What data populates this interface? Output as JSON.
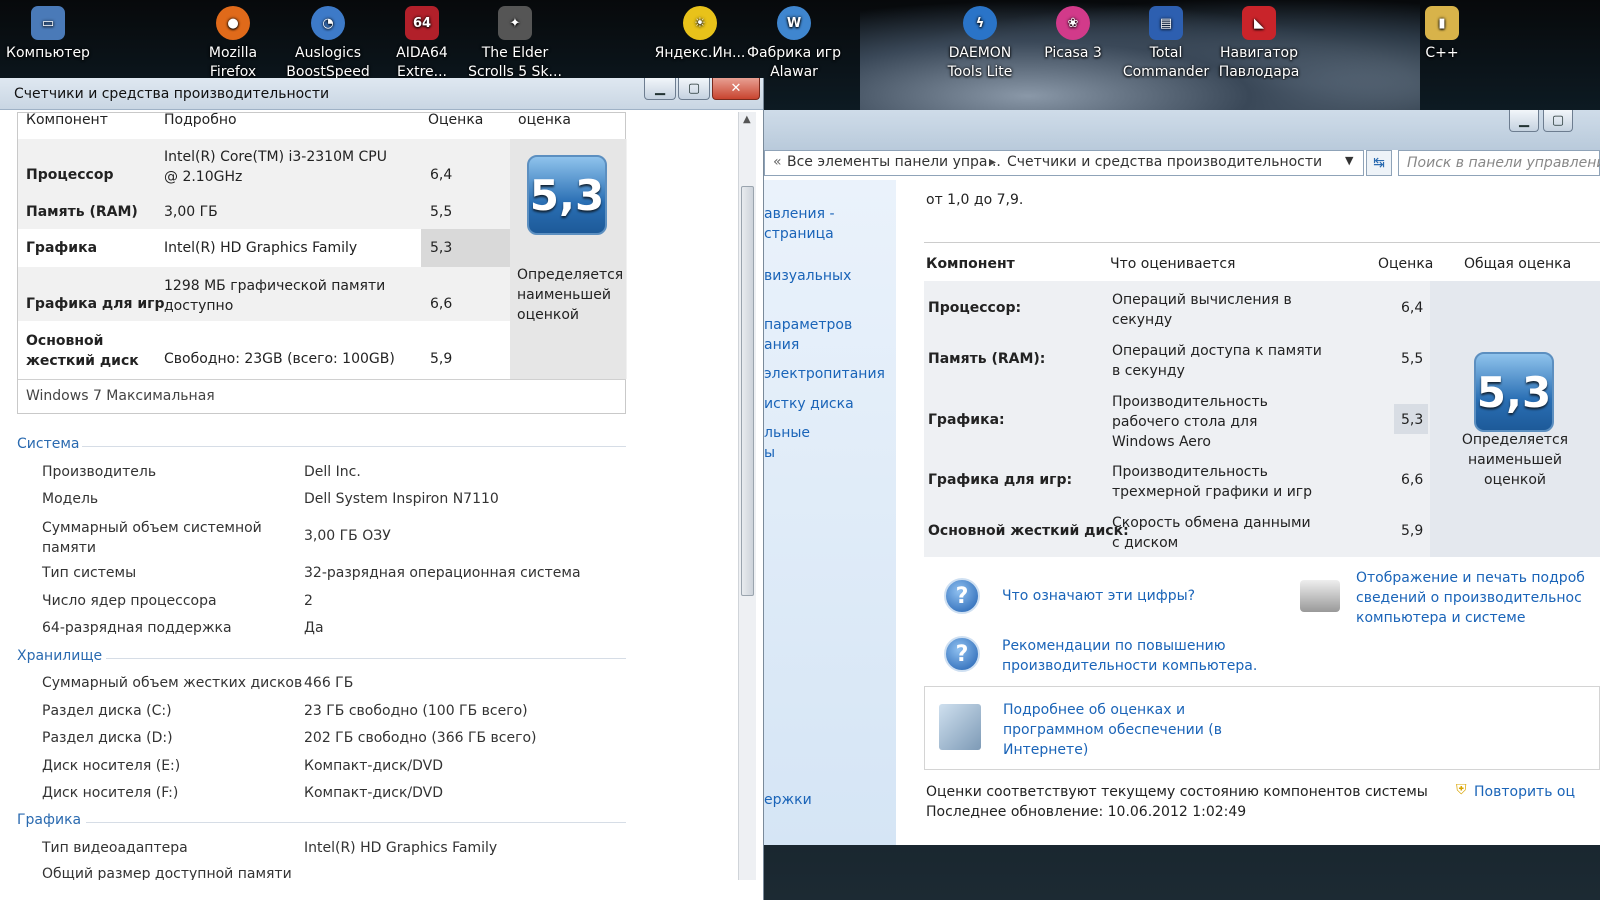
{
  "desktop": {
    "icons": [
      {
        "label": "Компьютер",
        "color": "#4a7ab8"
      },
      {
        "label": "Mozilla Firefox",
        "color": "#e06a1a"
      },
      {
        "label": "Auslogics BoostSpeed",
        "color": "#3d7ac8"
      },
      {
        "label": "AIDA64 Extre...",
        "color": "#b2202a"
      },
      {
        "label": "The Elder Scrolls 5 Sk...",
        "color": "#555555"
      },
      {
        "label": "Яндекс.Ин...",
        "color": "#e8c21a"
      },
      {
        "label": "Фабрика игр Alawar",
        "color": "#3f86cf"
      },
      {
        "label": "DAEMON Tools Lite",
        "color": "#2a74c8"
      },
      {
        "label": "Picasa 3",
        "color": "#d23a8a"
      },
      {
        "label": "Total Commander",
        "color": "#2d5fb0"
      },
      {
        "label": "Навигатор Павлодара",
        "color": "#c9242a"
      },
      {
        "label": "C++",
        "color": "#d8b34a"
      }
    ]
  },
  "left_window": {
    "title": "Счетчики и средства производительности",
    "buttons": {
      "minimize": "▁",
      "maximize": "▢",
      "close": "✕"
    },
    "score_table": {
      "headers": {
        "component": "Компонент",
        "details": "Подробно",
        "score": "Оценка",
        "overall": "оценка"
      },
      "rows": [
        {
          "component": "Процессор",
          "details": "Intel(R) Core(TM) i3-2310M CPU @ 2.10GHz",
          "score": "6,4"
        },
        {
          "component": "Память (RAM)",
          "details": "3,00 ГБ",
          "score": "5,5"
        },
        {
          "component": "Графика",
          "details": "Intel(R) HD Graphics Family",
          "score": "5,3"
        },
        {
          "component": "Графика для игр",
          "details": "1298 МБ графической памяти доступно",
          "score": "6,6"
        },
        {
          "component": "Основной жесткий диск",
          "details": "Свободно: 23GB (всего: 100GB)",
          "score": "5,9"
        }
      ],
      "base_score": "5,3",
      "base_note": "Определяется наименьшей оценкой",
      "os": "Windows 7 Максимальная"
    },
    "system": {
      "heading": "Система",
      "items": [
        {
          "key": "Производитель",
          "value": "Dell Inc."
        },
        {
          "key": "Модель",
          "value": "Dell System Inspiron N7110"
        },
        {
          "key": "Суммарный объем системной памяти",
          "value": "3,00 ГБ ОЗУ"
        },
        {
          "key": "Тип системы",
          "value": "32-разрядная операционная система"
        },
        {
          "key": "Число ядер процессора",
          "value": "2"
        },
        {
          "key": "64-разрядная поддержка",
          "value": "Да"
        }
      ]
    },
    "storage": {
      "heading": "Хранилище",
      "items": [
        {
          "key": "Суммарный объем жестких дисков",
          "value": "466 ГБ"
        },
        {
          "key": "Раздел диска (C:)",
          "value": "23 ГБ свободно (100 ГБ всего)"
        },
        {
          "key": "Раздел диска (D:)",
          "value": "202 ГБ свободно (366 ГБ всего)"
        },
        {
          "key": "Диск носителя (E:)",
          "value": "Компакт-диск/DVD"
        },
        {
          "key": "Диск носителя (F:)",
          "value": "Компакт-диск/DVD"
        }
      ]
    },
    "graphics": {
      "heading": "Графика",
      "items": [
        {
          "key": "Тип видеоадаптера",
          "value": "Intel(R) HD Graphics Family"
        },
        {
          "key": "Общий размер доступной памяти",
          "value": ""
        }
      ]
    }
  },
  "right_window": {
    "breadcrumb": [
      "Все элементы панели упра...",
      "Счетчики и средства производительности"
    ],
    "search_placeholder": "Поиск в панели управления",
    "sidebar": [
      "авления -",
      "страница",
      "визуальных",
      "параметров",
      "ания",
      "электропитания",
      "истку диска",
      "льные",
      "ы",
      "ержки"
    ],
    "intro_tail": "от 1,0 до 7,9.",
    "headers": {
      "component": "Компонент",
      "what": "Что оценивается",
      "score": "Оценка",
      "overall": "Общая оценка"
    },
    "rows": [
      {
        "component": "Процессор:",
        "what": "Операций вычисления в секунду",
        "score": "6,4"
      },
      {
        "component": "Память (RAM):",
        "what": "Операций доступа к памяти в секунду",
        "score": "5,5"
      },
      {
        "component": "Графика:",
        "what": "Производительность рабочего стола для Windows Aero",
        "score": "5,3"
      },
      {
        "component": "Графика для игр:",
        "what": "Производительность трехмерной графики и игр",
        "score": "6,6"
      },
      {
        "component": "Основной жесткий диск:",
        "what": "Скорость обмена данными с диском",
        "score": "5,9"
      }
    ],
    "base_score": "5,3",
    "base_note": "Определяется наименьшей оценкой",
    "links": {
      "what_numbers": "Что означают эти цифры?",
      "recommendations": "Рекомендации по повышению производительности компьютера.",
      "print": "Отображение и печать подроб сведений о производительнос компьютера и системе",
      "more_info": "Подробнее об оценках и программном обеспечении (в Интернете)",
      "repeat": "Повторить оц"
    },
    "footer": {
      "status": "Оценки соответствуют текущему состоянию компонентов системы",
      "updated": "Последнее обновление: 10.06.2012 1:02:49"
    }
  }
}
